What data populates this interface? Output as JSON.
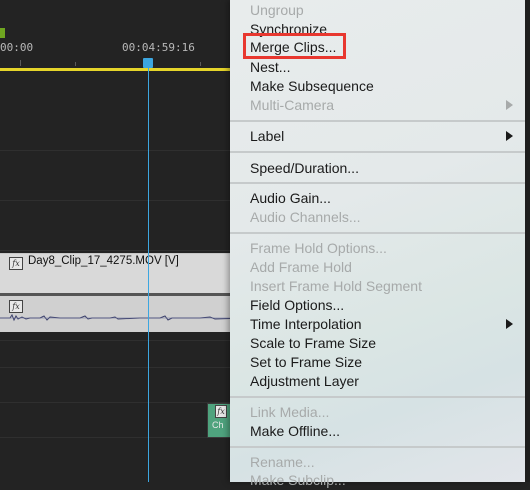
{
  "timeline": {
    "timecodes": [
      "00:00",
      "00:04:59:16"
    ],
    "video_clip_label": "Day8_Clip_17_4275.MOV [V]",
    "small_clip_label": "Ch",
    "fx_label": "fx",
    "colors": {
      "background": "#232323",
      "work_area_bar": "#e5d42a",
      "playhead": "#3ca6e0",
      "in_marker": "#6fa520",
      "clip_light": "#d9d9d9",
      "small_clip": "#4fa37e"
    }
  },
  "context_menu": {
    "items": {
      "ungroup": "Ungroup",
      "synchronize": "Synchronize",
      "merge_clips": "Merge Clips...",
      "nest": "Nest...",
      "make_subsequence": "Make Subsequence",
      "multi_camera": "Multi-Camera",
      "label": "Label",
      "speed_duration": "Speed/Duration...",
      "audio_gain": "Audio Gain...",
      "audio_channels": "Audio Channels...",
      "frame_hold_options": "Frame Hold Options...",
      "add_frame_hold": "Add Frame Hold",
      "insert_frame_hold_segment": "Insert Frame Hold Segment",
      "field_options": "Field Options...",
      "time_interpolation": "Time Interpolation",
      "scale_to_frame_size": "Scale to Frame Size",
      "set_to_frame_size": "Set to Frame Size",
      "adjustment_layer": "Adjustment Layer",
      "link_media": "Link Media...",
      "make_offline": "Make Offline...",
      "rename": "Rename...",
      "make_subclip": "Make Subclip..."
    },
    "highlight_color": "#e8372f"
  }
}
